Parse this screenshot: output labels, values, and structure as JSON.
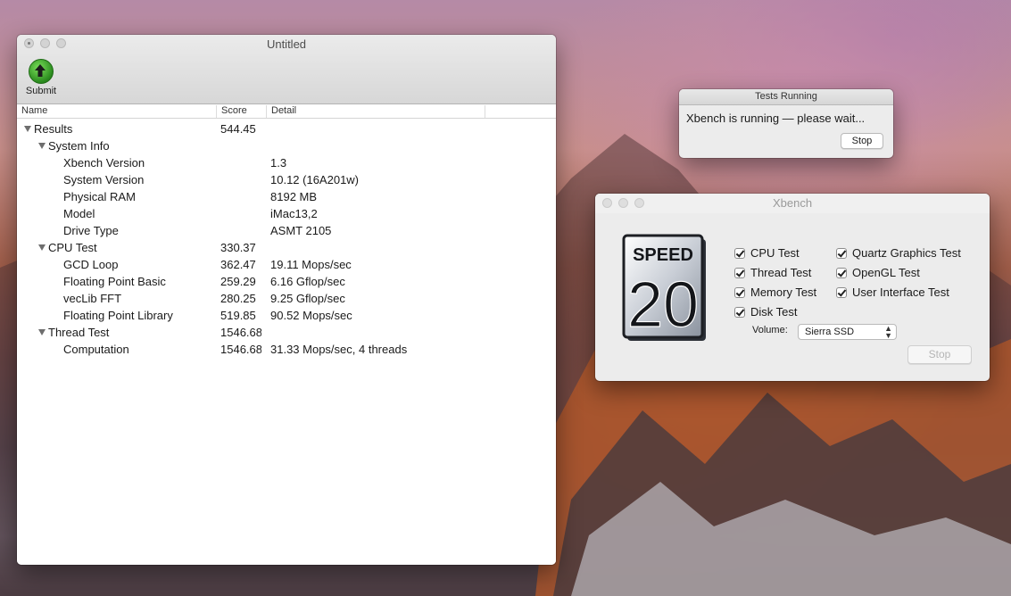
{
  "main_window": {
    "title": "Untitled",
    "toolbar": {
      "submit_label": "Submit"
    },
    "columns": {
      "name": "Name",
      "score": "Score",
      "detail": "Detail"
    },
    "rows": [
      {
        "level": 0,
        "expandable": true,
        "name": "Results",
        "score": "544.45",
        "detail": ""
      },
      {
        "level": 1,
        "expandable": true,
        "name": "System Info",
        "score": "",
        "detail": ""
      },
      {
        "level": 2,
        "expandable": false,
        "name": "Xbench Version",
        "score": "",
        "detail": "1.3"
      },
      {
        "level": 2,
        "expandable": false,
        "name": "System Version",
        "score": "",
        "detail": "10.12 (16A201w)"
      },
      {
        "level": 2,
        "expandable": false,
        "name": "Physical RAM",
        "score": "",
        "detail": "8192 MB"
      },
      {
        "level": 2,
        "expandable": false,
        "name": "Model",
        "score": "",
        "detail": "iMac13,2"
      },
      {
        "level": 2,
        "expandable": false,
        "name": "Drive Type",
        "score": "",
        "detail": "ASMT 2105"
      },
      {
        "level": 1,
        "expandable": true,
        "name": "CPU Test",
        "score": "330.37",
        "detail": ""
      },
      {
        "level": 2,
        "expandable": false,
        "name": "GCD Loop",
        "score": "362.47",
        "detail": "19.11 Mops/sec"
      },
      {
        "level": 2,
        "expandable": false,
        "name": "Floating Point Basic",
        "score": "259.29",
        "detail": "6.16 Gflop/sec"
      },
      {
        "level": 2,
        "expandable": false,
        "name": "vecLib FFT",
        "score": "280.25",
        "detail": "9.25 Gflop/sec"
      },
      {
        "level": 2,
        "expandable": false,
        "name": "Floating Point Library",
        "score": "519.85",
        "detail": "90.52 Mops/sec"
      },
      {
        "level": 1,
        "expandable": true,
        "name": "Thread Test",
        "score": "1546.68",
        "detail": ""
      },
      {
        "level": 2,
        "expandable": false,
        "name": "Computation",
        "score": "1546.68",
        "detail": "31.33 Mops/sec, 4 threads"
      }
    ]
  },
  "running_window": {
    "title": "Tests Running",
    "message": "Xbench is running — please wait...",
    "stop_label": "Stop"
  },
  "xbench_window": {
    "title": "Xbench",
    "logo": {
      "top_text": "SPEED",
      "number": "20"
    },
    "checkboxes": [
      {
        "label": "CPU Test",
        "checked": true
      },
      {
        "label": "Thread Test",
        "checked": true
      },
      {
        "label": "Memory Test",
        "checked": true
      },
      {
        "label": "Disk Test",
        "checked": true
      },
      {
        "label": "Quartz Graphics Test",
        "checked": true
      },
      {
        "label": "OpenGL Test",
        "checked": true
      },
      {
        "label": "User Interface Test",
        "checked": true
      }
    ],
    "volume_label": "Volume:",
    "volume_value": "Sierra SSD",
    "stop_label": "Stop"
  }
}
